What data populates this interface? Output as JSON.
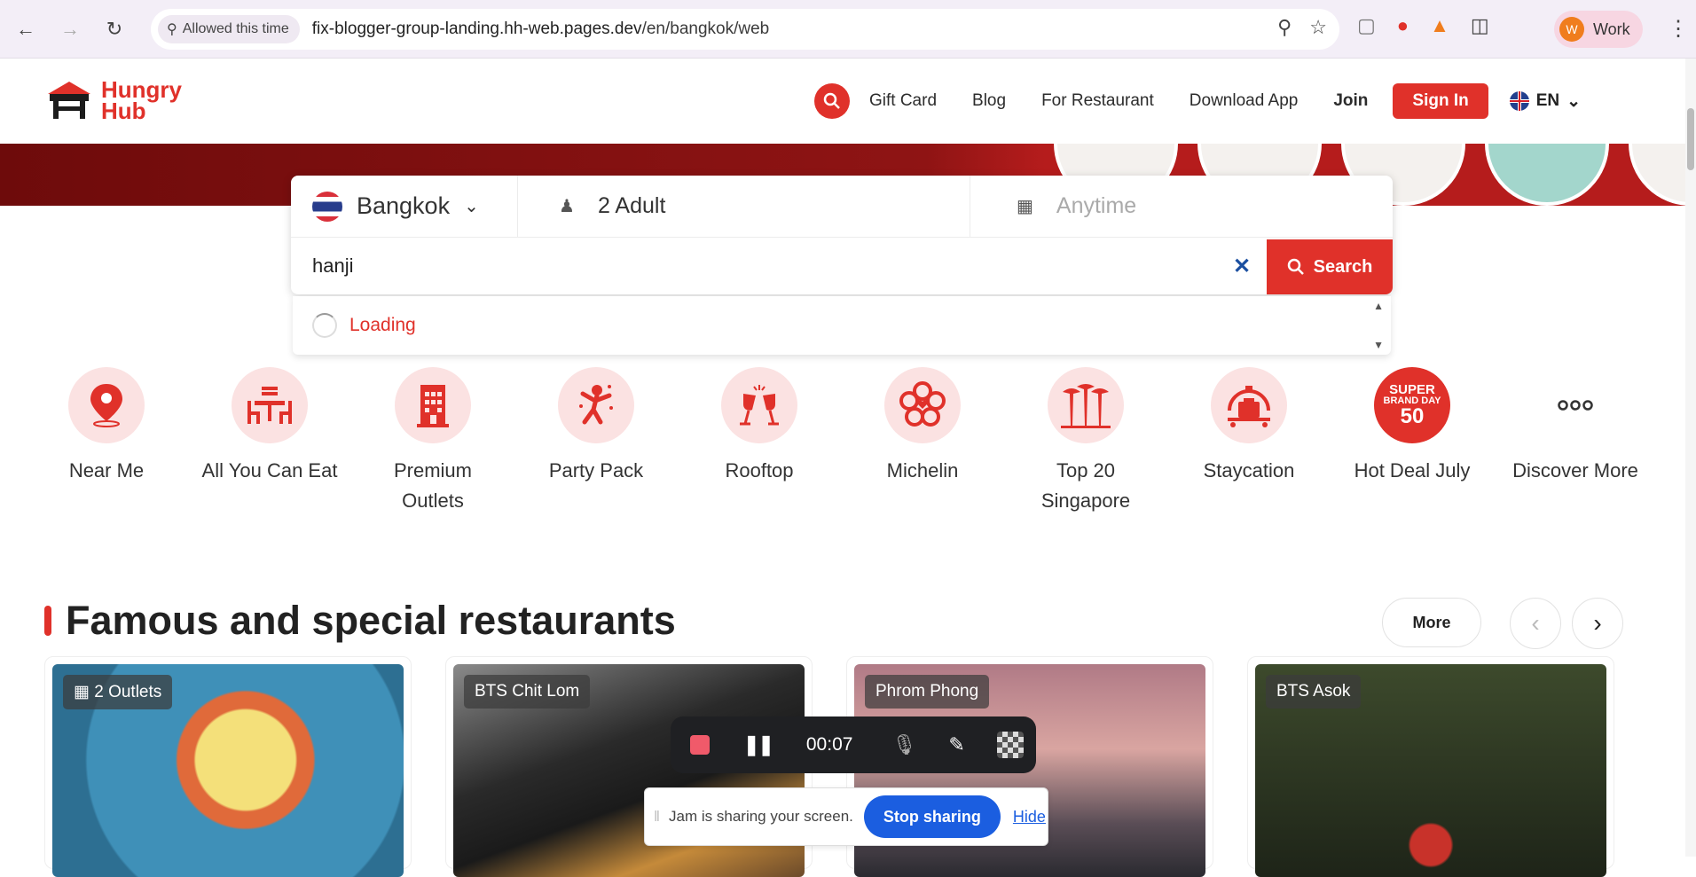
{
  "browser": {
    "permission_chip": "Allowed this time",
    "url_host": "fix-blogger-group-landing.hh-web.pages.dev",
    "url_path": "/en/bangkok/web",
    "profile_initial": "W",
    "profile_label": "Work"
  },
  "header": {
    "logo_line1": "Hungry",
    "logo_line2": "Hub",
    "nav": {
      "gift_card": "Gift Card",
      "blog": "Blog",
      "for_restaurant": "For Restaurant",
      "download_app": "Download App",
      "join": "Join",
      "sign_in": "Sign In",
      "language": "EN"
    }
  },
  "search": {
    "city": "Bangkok",
    "guests": "2 Adult",
    "date_placeholder": "Anytime",
    "query": "hanji",
    "button": "Search",
    "suggestion_status": "Loading"
  },
  "categories": [
    {
      "label": "Near Me",
      "icon": "location-pin-icon"
    },
    {
      "label": "All You Can Eat",
      "icon": "dining-table-icon"
    },
    {
      "label": "Premium Outlets",
      "icon": "hotel-building-icon"
    },
    {
      "label": "Party Pack",
      "icon": "party-person-icon"
    },
    {
      "label": "Rooftop",
      "icon": "wine-glasses-icon"
    },
    {
      "label": "Michelin",
      "icon": "michelin-flower-icon"
    },
    {
      "label": "Top 20 Singapore",
      "icon": "supertree-icon"
    },
    {
      "label": "Staycation",
      "icon": "luggage-icon"
    },
    {
      "label": "Hot Deal July",
      "icon": "super-brand-day-icon",
      "badge_line1": "SUPER",
      "badge_line2": "BRAND DAY",
      "badge_line3": "50"
    },
    {
      "label": "Discover More",
      "icon": "more-dots-icon"
    }
  ],
  "section": {
    "title": "Famous and special restaurants",
    "more": "More"
  },
  "cards": [
    {
      "tag": "2 Outlets",
      "color": "#4a8fb0"
    },
    {
      "tag": "BTS Chit Lom",
      "color": "#3a3a3a"
    },
    {
      "tag": "Phrom Phong",
      "color": "#b07a86"
    },
    {
      "tag": "BTS Asok",
      "color": "#3d4a2c"
    }
  ],
  "recorder": {
    "time": "00:07",
    "share_text": "Jam is sharing your screen.",
    "stop_sharing": "Stop sharing",
    "hide": "Hide"
  },
  "colors": {
    "brand": "#e0312a",
    "share_blue": "#1b5ee0"
  }
}
